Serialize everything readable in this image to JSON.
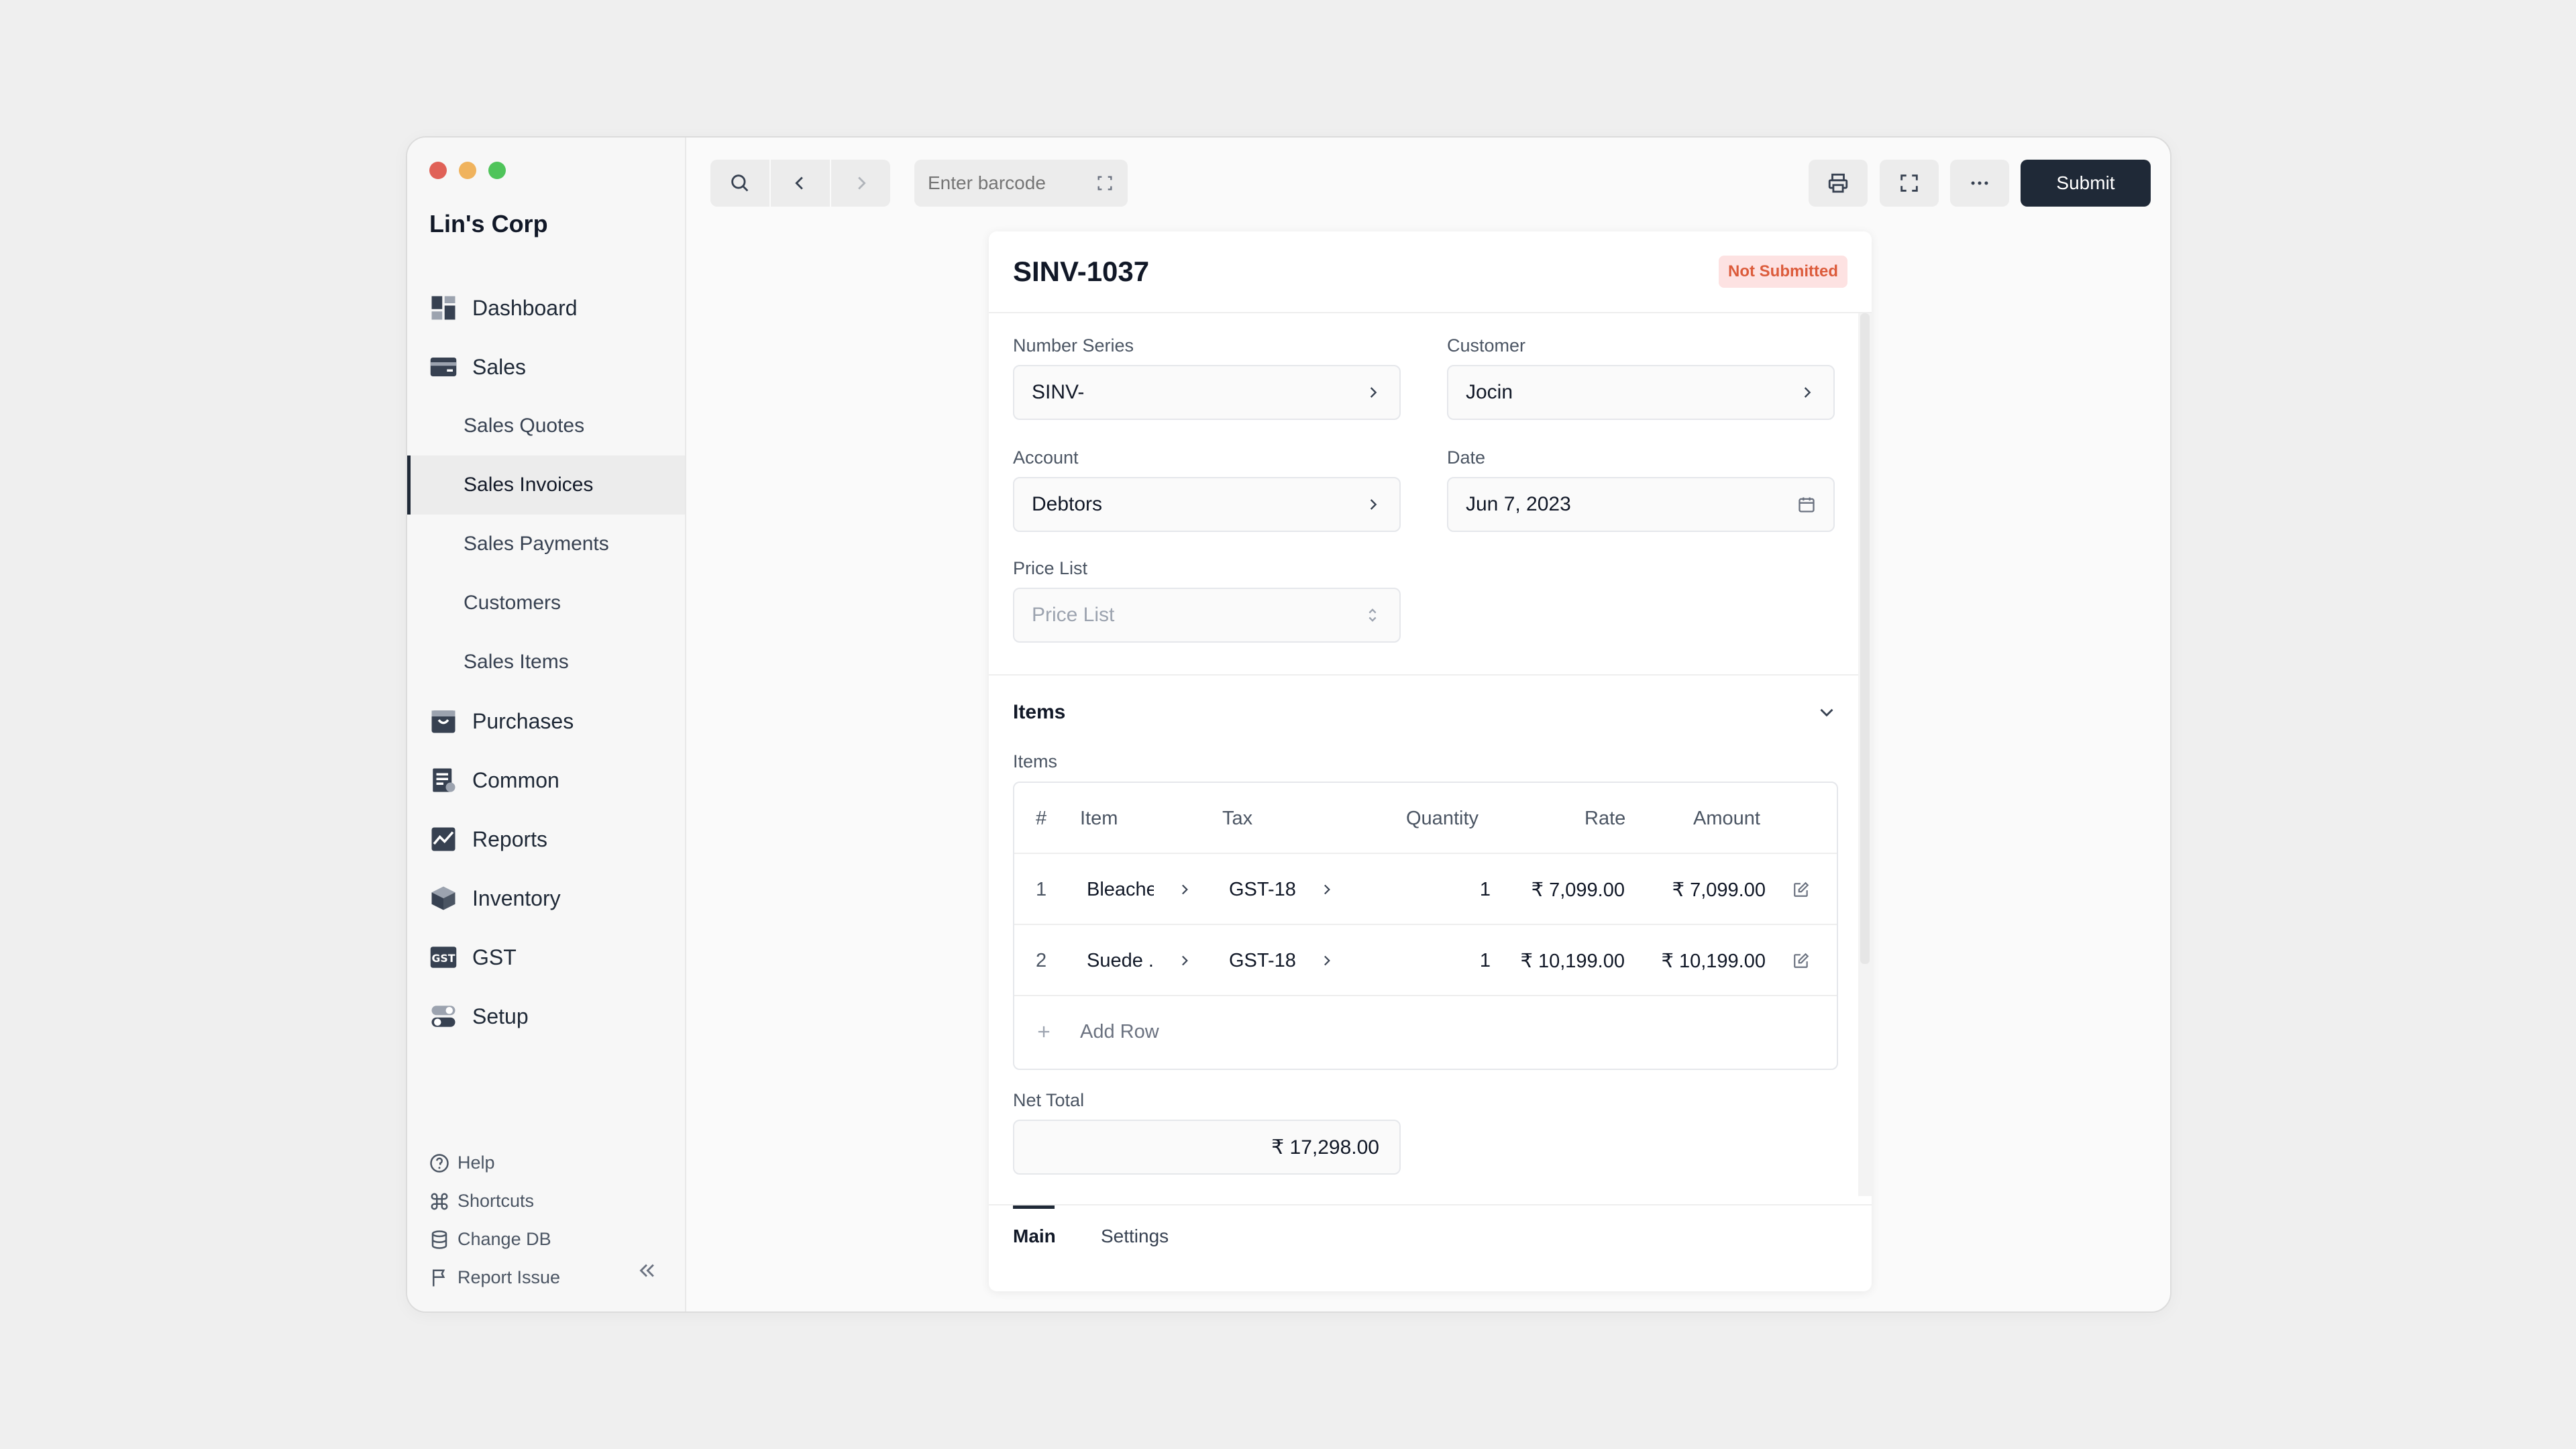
{
  "sidebar": {
    "company": "Lin's Corp",
    "nav": [
      {
        "label": "Dashboard",
        "icon": "dashboard-icon"
      },
      {
        "label": "Sales",
        "icon": "sales-icon"
      },
      {
        "label": "Purchases",
        "icon": "purchases-icon"
      },
      {
        "label": "Common",
        "icon": "common-icon"
      },
      {
        "label": "Reports",
        "icon": "reports-icon"
      },
      {
        "label": "Inventory",
        "icon": "inventory-icon"
      },
      {
        "label": "GST",
        "icon": "gst-icon"
      },
      {
        "label": "Setup",
        "icon": "setup-icon"
      }
    ],
    "sales_sub": [
      {
        "label": "Sales Quotes"
      },
      {
        "label": "Sales Invoices",
        "active": true
      },
      {
        "label": "Sales Payments"
      },
      {
        "label": "Customers"
      },
      {
        "label": "Sales Items"
      }
    ],
    "bottom": [
      {
        "label": "Help",
        "icon": "help-icon"
      },
      {
        "label": "Shortcuts",
        "icon": "shortcuts-icon"
      },
      {
        "label": "Change DB",
        "icon": "database-icon"
      },
      {
        "label": "Report Issue",
        "icon": "flag-icon"
      }
    ]
  },
  "toolbar": {
    "barcode_placeholder": "Enter barcode",
    "submit_label": "Submit"
  },
  "invoice": {
    "title": "SINV-1037",
    "status": "Not Submitted",
    "status_color": "#dc5b3b",
    "fields": {
      "number_series": {
        "label": "Number Series",
        "value": "SINV-"
      },
      "customer": {
        "label": "Customer",
        "value": "Jocin"
      },
      "account": {
        "label": "Account",
        "value": "Debtors"
      },
      "date": {
        "label": "Date",
        "value": "Jun 7, 2023"
      },
      "price_list": {
        "label": "Price List",
        "placeholder": "Price List"
      }
    },
    "items_section_title": "Items",
    "items_label": "Items",
    "table": {
      "headers": {
        "num": "#",
        "item": "Item",
        "tax": "Tax",
        "quantity": "Quantity",
        "rate": "Rate",
        "amount": "Amount"
      },
      "rows": [
        {
          "num": "1",
          "item": "Bleachе",
          "tax": "GST-18",
          "quantity": "1",
          "rate": "₹ 7,099.00",
          "amount": "₹ 7,099.00"
        },
        {
          "num": "2",
          "item": "Suede .",
          "tax": "GST-18",
          "quantity": "1",
          "rate": "₹ 10,199.00",
          "amount": "₹ 10,199.00"
        }
      ],
      "add_row": "Add Row"
    },
    "net_total": {
      "label": "Net Total",
      "value": "₹ 17,298.00"
    },
    "tabs": [
      {
        "label": "Main",
        "active": true
      },
      {
        "label": "Settings"
      }
    ]
  },
  "colors": {
    "accent": "#1f2937",
    "window_bg": "#fafafa",
    "page_bg": "#efefef"
  }
}
